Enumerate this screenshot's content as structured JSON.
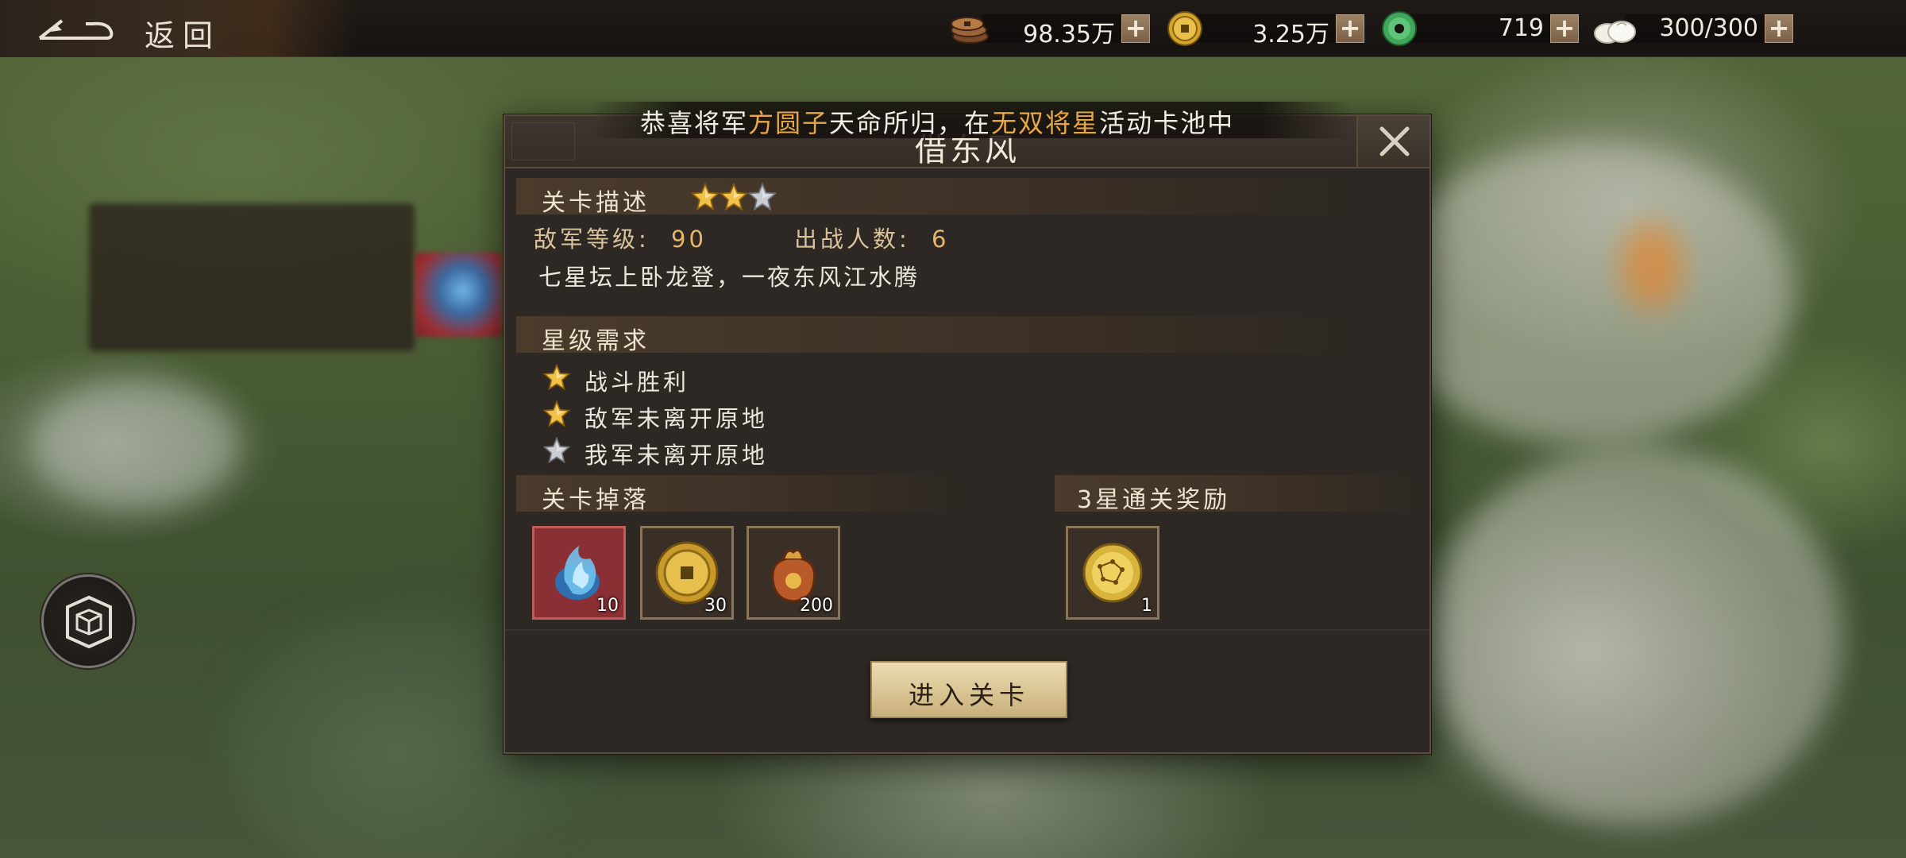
{
  "top_bar": {
    "back_label": "返回",
    "resources": [
      {
        "name": "copper-coins",
        "value": "98.35万"
      },
      {
        "name": "gold-coin",
        "value": "3.25万"
      },
      {
        "name": "jade",
        "value": "719"
      },
      {
        "name": "stamina-bun",
        "value": "300/300"
      }
    ],
    "plus_label": "+"
  },
  "notice": {
    "prefix": "恭喜将军",
    "player": "方圆子",
    "middle": "天命所归，在",
    "pool": "无双将星",
    "suffix": "活动卡池中"
  },
  "modal": {
    "title": "借东风",
    "stage_desc": {
      "header": "关卡描述",
      "stars_earned": 2,
      "stars_total": 3,
      "enemy_level_label": "敌军等级:",
      "enemy_level": "90",
      "troop_count_label": "出战人数:",
      "troop_count": "6",
      "description": "七星坛上卧龙登，一夜东风江水腾"
    },
    "star_requirements": {
      "header": "星级需求",
      "items": [
        {
          "text": "战斗胜利",
          "achieved": true
        },
        {
          "text": "敌军未离开原地",
          "achieved": true
        },
        {
          "text": "我军未离开原地",
          "achieved": false
        }
      ]
    },
    "drops": {
      "header": "关卡掉落",
      "items": [
        {
          "icon": "blue-flame-orb-icon",
          "count": "10"
        },
        {
          "icon": "gold-coin-icon",
          "count": "30"
        },
        {
          "icon": "money-bag-icon",
          "count": "200"
        }
      ]
    },
    "rewards": {
      "header": "3星通关奖励",
      "items": [
        {
          "icon": "constellation-orb-icon",
          "count": "1"
        }
      ]
    },
    "enter_button": "进入关卡"
  },
  "colors": {
    "accent_orange": "#e9a645",
    "star_gold": "#f1c24a",
    "star_silver": "#c9ccd2",
    "button_beige": "#d9c493"
  }
}
